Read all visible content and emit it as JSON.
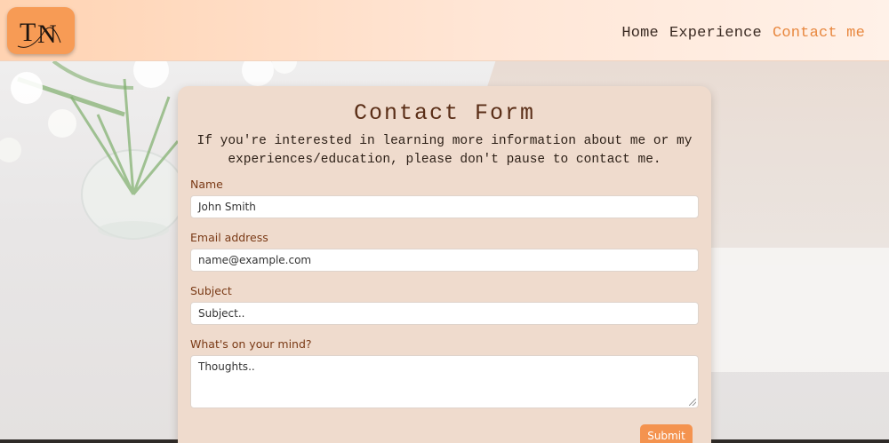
{
  "logo": {
    "text": "TN",
    "icon": "monogram-logo"
  },
  "nav": {
    "items": [
      {
        "label": "Home",
        "active": false
      },
      {
        "label": "Experience",
        "active": false
      },
      {
        "label": "Contact me",
        "active": true
      }
    ]
  },
  "form": {
    "title": "Contact Form",
    "description": "If you're interested in learning more information about me or my experiences/education, please don't pause to contact me.",
    "fields": {
      "name": {
        "label": "Name",
        "value": "John Smith"
      },
      "email": {
        "label": "Email address",
        "placeholder": "name@example.com"
      },
      "subject": {
        "label": "Subject",
        "placeholder": "Subject.."
      },
      "message": {
        "label": "What's on your mind?",
        "placeholder": "Thoughts.."
      }
    },
    "submit_label": "Submit"
  },
  "colors": {
    "accent": "#e8873e",
    "card": "#efdbcd",
    "button": "#f4934f",
    "label": "#7a3a16"
  }
}
